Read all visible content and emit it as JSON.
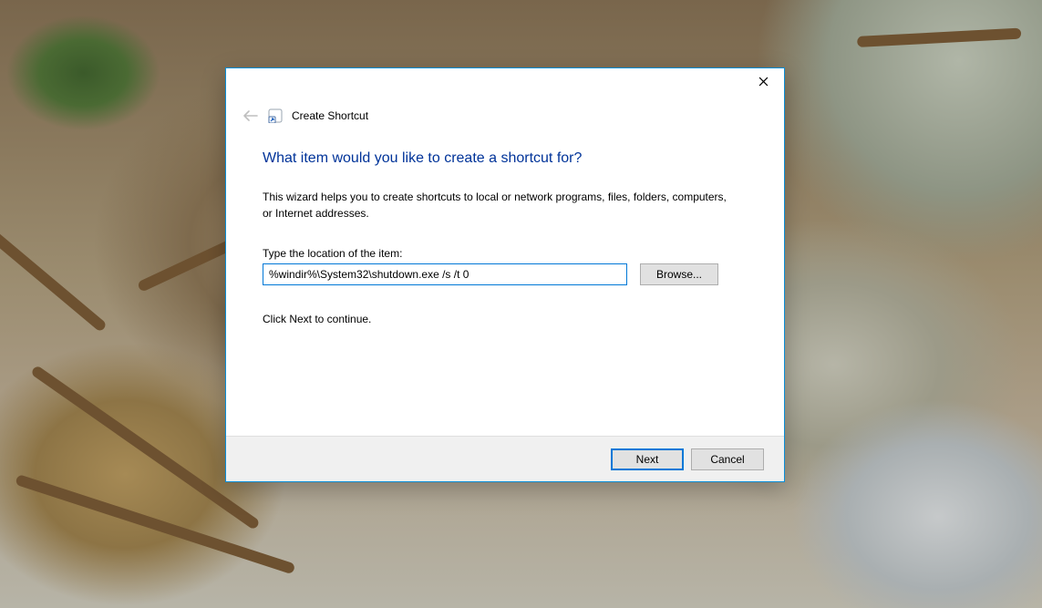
{
  "dialog": {
    "title": "Create Shortcut",
    "heading": "What item would you like to create a shortcut for?",
    "description": "This wizard helps you to create shortcuts to local or network programs, files, folders, computers, or Internet addresses.",
    "location_label": "Type the location of the item:",
    "location_value": "%windir%\\System32\\shutdown.exe /s /t 0",
    "browse_label": "Browse...",
    "continue_text": "Click Next to continue.",
    "next_label": "Next",
    "cancel_label": "Cancel"
  }
}
